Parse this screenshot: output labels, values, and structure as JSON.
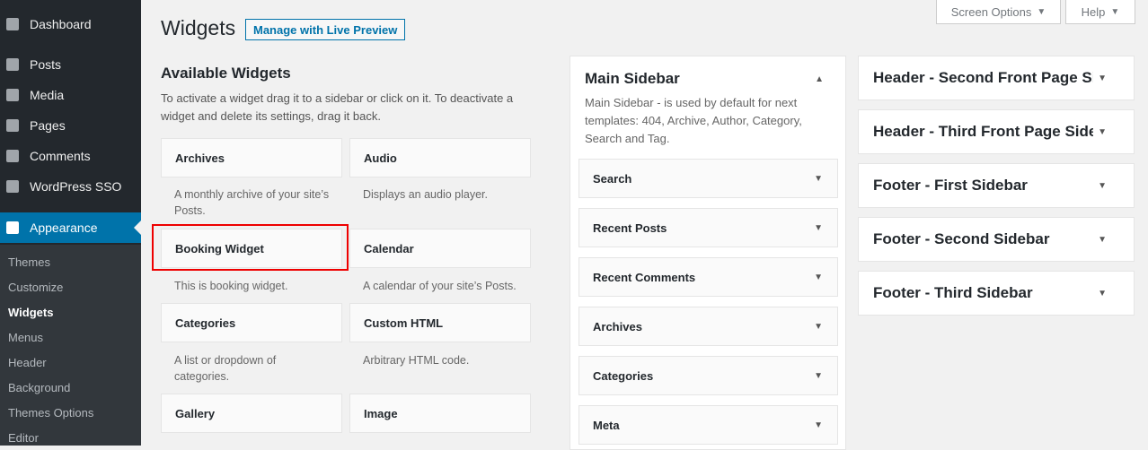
{
  "menu": {
    "dashboard": "Dashboard",
    "posts": "Posts",
    "media": "Media",
    "pages": "Pages",
    "comments": "Comments",
    "sso": "WordPress SSO",
    "appearance": "Appearance",
    "submenu": [
      "Themes",
      "Customize",
      "Widgets",
      "Menus",
      "Header",
      "Background",
      "Themes Options",
      "Editor"
    ]
  },
  "header": {
    "title": "Widgets",
    "live_preview": "Manage with Live Preview",
    "screen_options": "Screen Options",
    "help": "Help"
  },
  "available": {
    "title": "Available Widgets",
    "desc": "To activate a widget drag it to a sidebar or click on it. To deactivate a widget and delete its settings, drag it back.",
    "widgets": [
      {
        "name": "Archives",
        "desc": "A monthly archive of your site’s Posts."
      },
      {
        "name": "Audio",
        "desc": "Displays an audio player."
      },
      {
        "name": "Booking Widget",
        "desc": "This is booking widget."
      },
      {
        "name": "Calendar",
        "desc": "A calendar of your site’s Posts."
      },
      {
        "name": "Categories",
        "desc": "A list or dropdown of categories."
      },
      {
        "name": "Custom HTML",
        "desc": "Arbitrary HTML code."
      },
      {
        "name": "Gallery",
        "desc": ""
      },
      {
        "name": "Image",
        "desc": ""
      }
    ]
  },
  "main_sidebar": {
    "title": "Main Sidebar",
    "desc": "Main Sidebar - is used by default for next templates: 404, Archive, Author, Category, Search and Tag.",
    "widgets": [
      "Search",
      "Recent Posts",
      "Recent Comments",
      "Archives",
      "Categories",
      "Meta"
    ]
  },
  "right_sidebars": [
    "Header - Second Front Page Si",
    "Header - Third Front Page Side",
    "Footer - First Sidebar",
    "Footer - Second Sidebar",
    "Footer - Third Sidebar"
  ],
  "icons": {
    "caret_down": "▼",
    "caret_up": "▲"
  }
}
